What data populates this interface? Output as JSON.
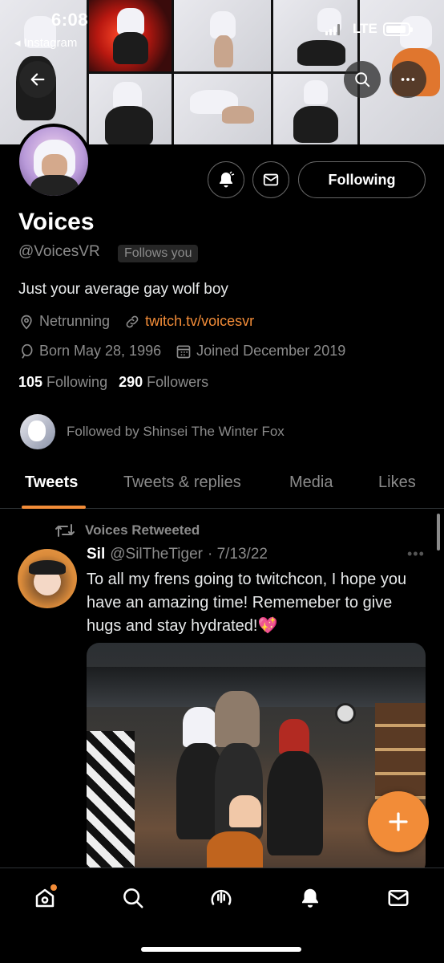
{
  "status_bar": {
    "time": "6:08",
    "back_app": "◂ Instagram",
    "network": "LTE"
  },
  "profile": {
    "name": "Voices",
    "handle": "@VoicesVR",
    "follows_you": "Follows you",
    "bio": "Just your average gay wolf boy",
    "location": "Netrunning",
    "website": "twitch.tv/voicesvr",
    "born": "Born May 28, 1996",
    "joined": "Joined December 2019",
    "following_count": "105",
    "following_label": "Following",
    "followers_count": "290",
    "followers_label": "Followers",
    "followed_by": "Followed by Shinsei The Winter Fox",
    "following_button": "Following"
  },
  "tabs": [
    "Tweets",
    "Tweets & replies",
    "Media",
    "Likes"
  ],
  "tweet": {
    "retweet_label": "Voices Retweeted",
    "author_name": "Sil",
    "author_handle": "@SilTheTiger",
    "date": "· 7/13/22",
    "text": "To all my frens going to twitchcon, I hope you have an amazing time! Rememeber to give hugs and stay hydrated!",
    "emoji": "💖"
  },
  "colors": {
    "accent": "#f28c38",
    "background": "#000000",
    "muted": "#8b8b8b"
  },
  "icons": [
    "back-arrow-icon",
    "search-icon",
    "more-icon",
    "bell-icon",
    "mail-icon",
    "location-icon",
    "link-icon",
    "balloon-icon",
    "calendar-icon",
    "retweet-icon",
    "compose-icon",
    "home-icon",
    "spaces-icon"
  ]
}
